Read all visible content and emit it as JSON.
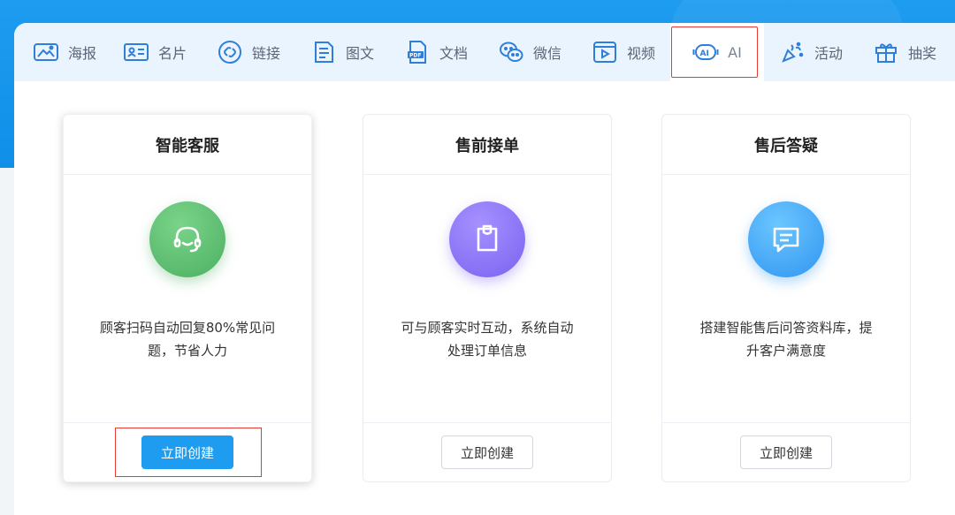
{
  "tabs": [
    {
      "label": "海报",
      "icon": "poster-icon"
    },
    {
      "label": "名片",
      "icon": "business-card-icon"
    },
    {
      "label": "链接",
      "icon": "link-icon"
    },
    {
      "label": "图文",
      "icon": "article-icon"
    },
    {
      "label": "文档",
      "icon": "pdf-document-icon"
    },
    {
      "label": "微信",
      "icon": "wechat-icon"
    },
    {
      "label": "视频",
      "icon": "video-icon"
    },
    {
      "label": "AI",
      "icon": "ai-icon",
      "active": true
    },
    {
      "label": "活动",
      "icon": "activity-icon"
    },
    {
      "label": "抽奖",
      "icon": "gift-icon"
    }
  ],
  "cards": [
    {
      "title": "智能客服",
      "icon": "headset-icon",
      "desc_line1": "顾客扫码自动回复80%常见问",
      "desc_line2": "题，节省人力",
      "button": "立即创建",
      "color": "#4caf61"
    },
    {
      "title": "售前接单",
      "icon": "clipboard-icon",
      "desc_line1": "可与顾客实时互动，系统自动",
      "desc_line2": "处理订单信息",
      "button": "立即创建",
      "color": "#7b62f0"
    },
    {
      "title": "售后答疑",
      "icon": "chat-bubble-icon",
      "desc_line1": "搭建智能售后问答资料库，提",
      "desc_line2": "升客户满意度",
      "button": "立即创建",
      "color": "#2f95f0"
    }
  ],
  "colors": {
    "brand": "#1e9cf0",
    "tab_text": "#5a6577",
    "highlight": "#e53935"
  }
}
